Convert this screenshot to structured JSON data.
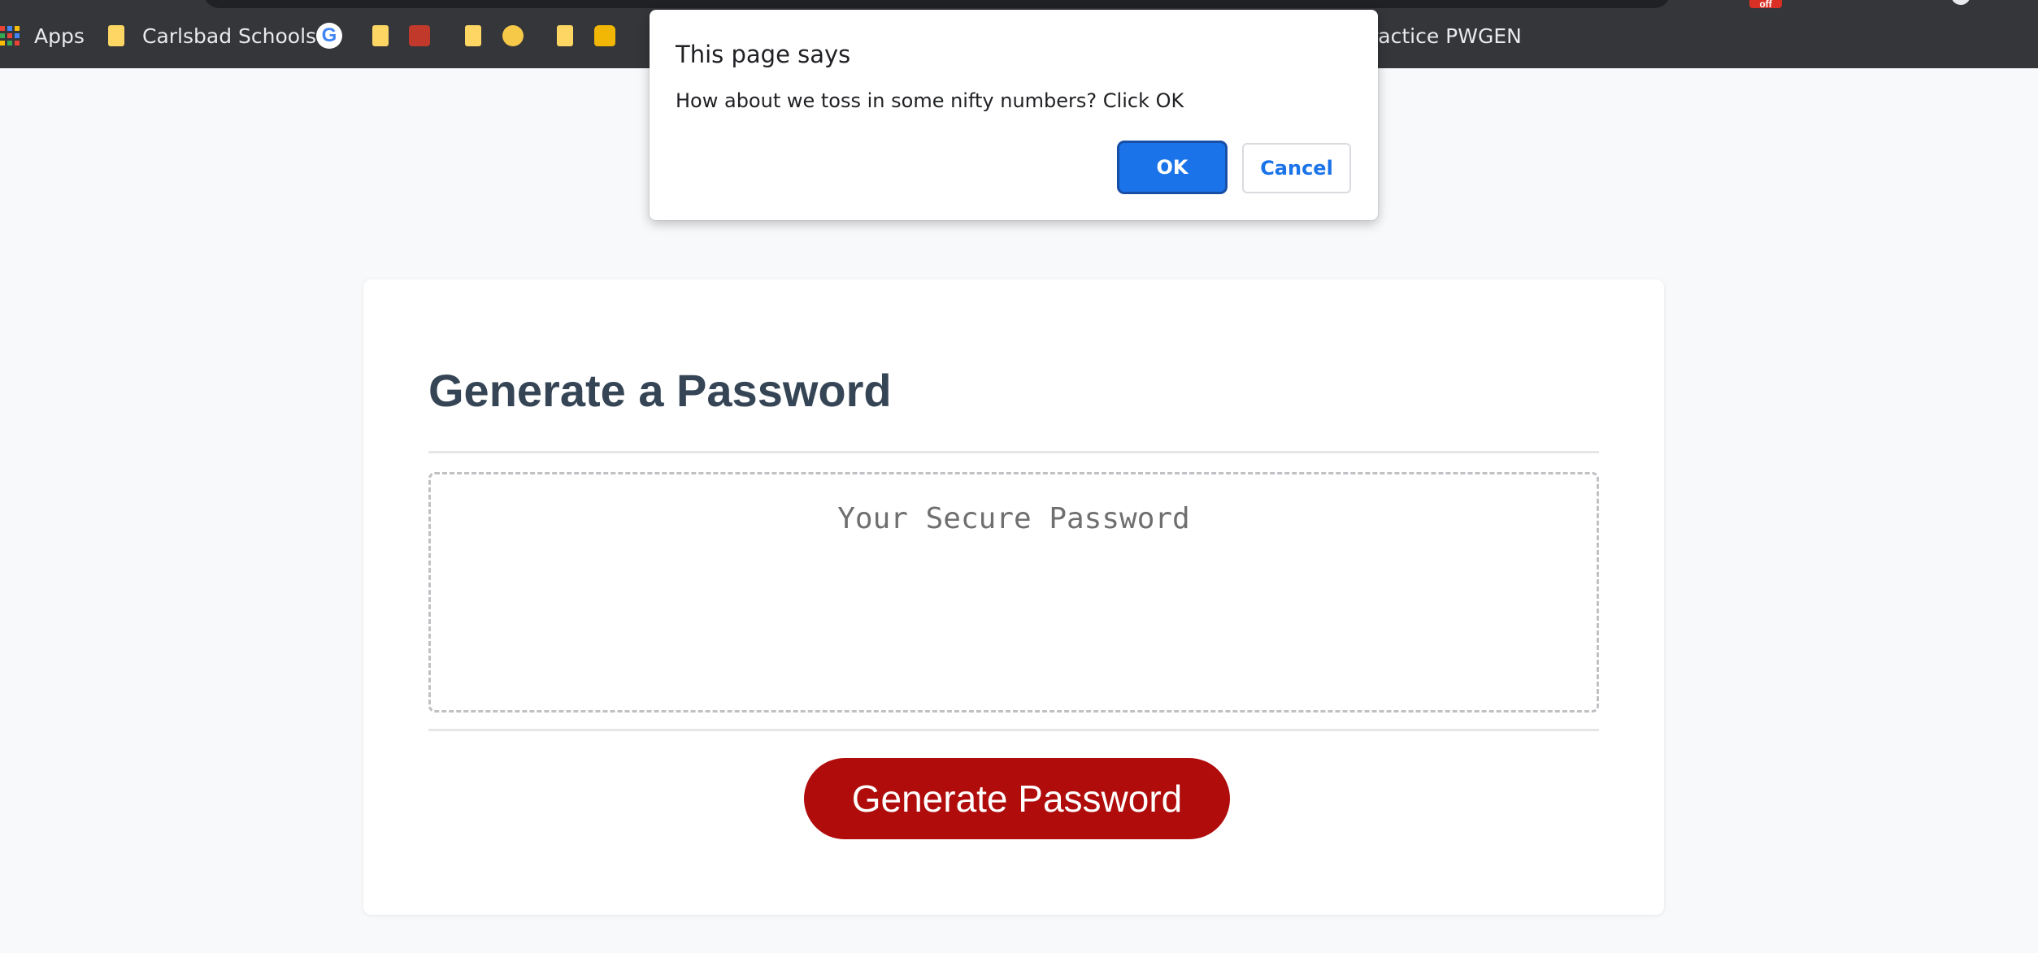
{
  "bookmarks_bar": {
    "items": [
      {
        "label": "Apps",
        "icon": "apps-grid-icon"
      },
      {
        "label": "Carlsbad Schools",
        "icon": "folder-icon"
      },
      {
        "label": "",
        "icon": "google-icon"
      },
      {
        "label": "",
        "icon": "folder-icon"
      },
      {
        "label": "",
        "icon": "school-emoji-icon"
      },
      {
        "label": "",
        "icon": "folder-icon"
      },
      {
        "label": "",
        "icon": "nerd-face-emoji-icon"
      },
      {
        "label": "",
        "icon": "folder-icon"
      },
      {
        "label": "",
        "icon": "lock-emoji-icon"
      },
      {
        "label": "ractice PWGEN",
        "icon": "folder-icon"
      }
    ],
    "google_glyph": "G",
    "extension_badge": "off",
    "colors": {
      "bar": "#35363a",
      "text": "#e8eaed",
      "folder": "#fdd663"
    }
  },
  "dialog": {
    "title": "This page says",
    "message": "How about we toss in some nifty numbers? Click OK",
    "ok_label": "OK",
    "cancel_label": "Cancel",
    "accent": "#1a73e8"
  },
  "card": {
    "title": "Generate a Password",
    "password_placeholder": "Your Secure Password",
    "password_value": "",
    "generate_label": "Generate Password",
    "colors": {
      "title": "#354555",
      "button": "#b00c0c",
      "page_bg": "#f8f9fb"
    }
  }
}
